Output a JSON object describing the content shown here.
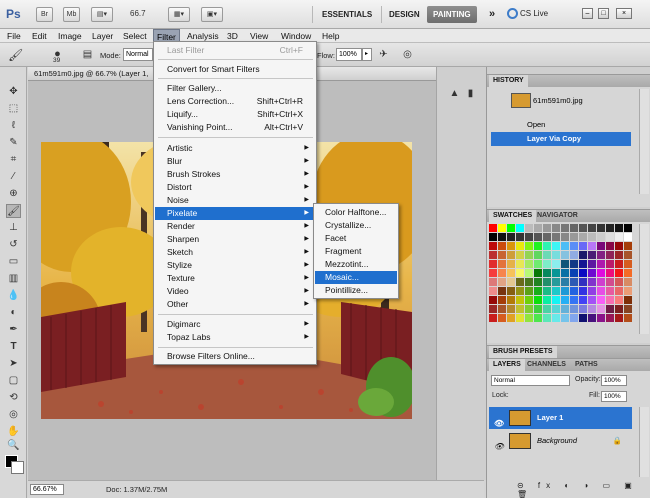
{
  "app": {
    "logo": "Ps",
    "btn_br": "Br",
    "btn_mb": "Mb",
    "zoom": "66.7",
    "workspaces": [
      "ESSENTIALS",
      "DESIGN",
      "PAINTING"
    ],
    "active_workspace": "PAINTING",
    "more": "»",
    "cs_live": "CS Live",
    "win_min": "–",
    "win_max": "□",
    "win_close": "×"
  },
  "menubar": [
    "File",
    "Edit",
    "Image",
    "Layer",
    "Select",
    "Filter",
    "Analysis",
    "3D",
    "View",
    "Window",
    "Help"
  ],
  "active_menu": "Filter",
  "options": {
    "mode_label": "Mode:",
    "mode_value": "Normal",
    "flow_label": "Flow:",
    "flow_value": "100%",
    "brush_size": "39"
  },
  "document": {
    "tab_title": "61m591m0.jpg @ 66.7% (Layer 1,",
    "status_zoom": "66.67%",
    "status_doc": "Doc: 1.37M/2.75M"
  },
  "filter_menu": {
    "last_filter": "Last Filter",
    "last_filter_shortcut": "Ctrl+F",
    "convert_smart": "Convert for Smart Filters",
    "gallery": "Filter Gallery...",
    "lens": "Lens Correction...",
    "lens_shortcut": "Shift+Ctrl+R",
    "liquify": "Liquify...",
    "liquify_shortcut": "Shift+Ctrl+X",
    "vanishing": "Vanishing Point...",
    "vanishing_shortcut": "Alt+Ctrl+V",
    "groups": [
      "Artistic",
      "Blur",
      "Brush Strokes",
      "Distort",
      "Noise",
      "Pixelate",
      "Render",
      "Sharpen",
      "Sketch",
      "Stylize",
      "Texture",
      "Video",
      "Other"
    ],
    "plugins": [
      "Digimarc",
      "Topaz Labs"
    ],
    "browse": "Browse Filters Online..."
  },
  "pixelate_menu": {
    "items": [
      "Color Halftone...",
      "Crystallize...",
      "Facet",
      "Fragment",
      "Mezzotint...",
      "Mosaic...",
      "Pointillize..."
    ],
    "highlighted": "Mosaic..."
  },
  "history": {
    "tab": "HISTORY",
    "snapshot": "61m591m0.jpg",
    "states": [
      "Open",
      "Layer Via Copy"
    ]
  },
  "swatches": {
    "tabs": [
      "SWATCHES",
      "NAVIGATOR"
    ]
  },
  "brush_presets": {
    "tab": "BRUSH PRESETS"
  },
  "layers": {
    "tabs": [
      "LAYERS",
      "CHANNELS",
      "PATHS"
    ],
    "blend_mode": "Normal",
    "opacity_label": "Opacity:",
    "opacity_value": "100%",
    "lock_label": "Lock:",
    "fill_label": "Fill:",
    "fill_value": "100%",
    "items": [
      "Layer 1",
      "Background"
    ]
  },
  "colors": {
    "highlight": "#1f6fce",
    "appbar_active": "#7a7a7a"
  }
}
